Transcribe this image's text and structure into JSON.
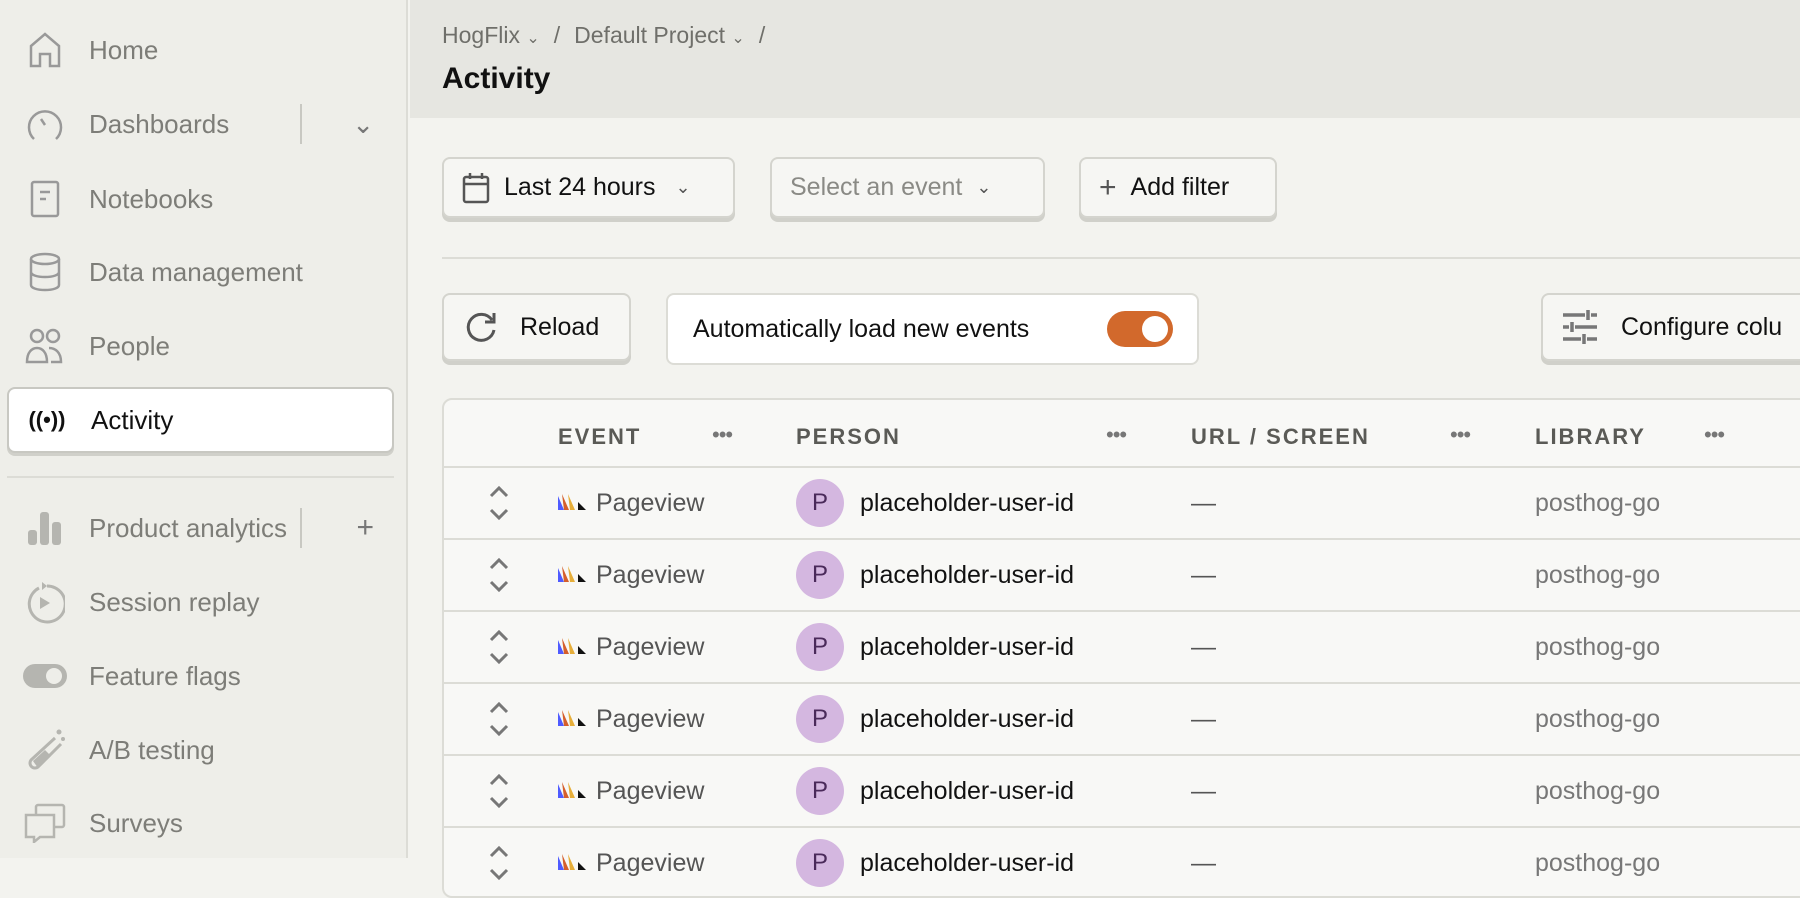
{
  "sidebar": {
    "items": [
      {
        "label": "Home",
        "icon": "home-icon"
      },
      {
        "label": "Dashboards",
        "icon": "dashboard-icon"
      },
      {
        "label": "Notebooks",
        "icon": "notebook-icon"
      },
      {
        "label": "Data management",
        "icon": "database-icon"
      },
      {
        "label": "People",
        "icon": "people-icon"
      },
      {
        "label": "Activity",
        "icon": "broadcast-icon",
        "active": true
      },
      {
        "label": "Product analytics",
        "icon": "bar-chart-icon"
      },
      {
        "label": "Session replay",
        "icon": "replay-icon"
      },
      {
        "label": "Feature flags",
        "icon": "toggle-icon"
      },
      {
        "label": "A/B testing",
        "icon": "flask-icon"
      },
      {
        "label": "Surveys",
        "icon": "chat-icon"
      }
    ],
    "dashboards_expand": "⌄",
    "product_analytics_add": "+"
  },
  "header": {
    "breadcrumb": [
      "HogFlix",
      "Default Project"
    ],
    "separator": "/",
    "title": "Activity"
  },
  "filters": {
    "date_range": "Last 24 hours",
    "event_placeholder": "Select an event",
    "add_filter": "Add filter"
  },
  "toolbar": {
    "reload": "Reload",
    "auto_load": "Automatically load new events",
    "auto_load_on": true,
    "configure_columns": "Configure colu",
    "toggle_color": "#d2692c"
  },
  "table": {
    "columns": [
      "EVENT",
      "PERSON",
      "URL / SCREEN",
      "LIBRARY"
    ],
    "more": "•••",
    "rows": [
      {
        "event": "Pageview",
        "avatar": "P",
        "person": "placeholder-user-id",
        "url": "—",
        "library": "posthog-go"
      },
      {
        "event": "Pageview",
        "avatar": "P",
        "person": "placeholder-user-id",
        "url": "—",
        "library": "posthog-go"
      },
      {
        "event": "Pageview",
        "avatar": "P",
        "person": "placeholder-user-id",
        "url": "—",
        "library": "posthog-go"
      },
      {
        "event": "Pageview",
        "avatar": "P",
        "person": "placeholder-user-id",
        "url": "—",
        "library": "posthog-go"
      },
      {
        "event": "Pageview",
        "avatar": "P",
        "person": "placeholder-user-id",
        "url": "—",
        "library": "posthog-go"
      },
      {
        "event": "Pageview",
        "avatar": "P",
        "person": "placeholder-user-id",
        "url": "—",
        "library": "posthog-go"
      }
    ]
  }
}
